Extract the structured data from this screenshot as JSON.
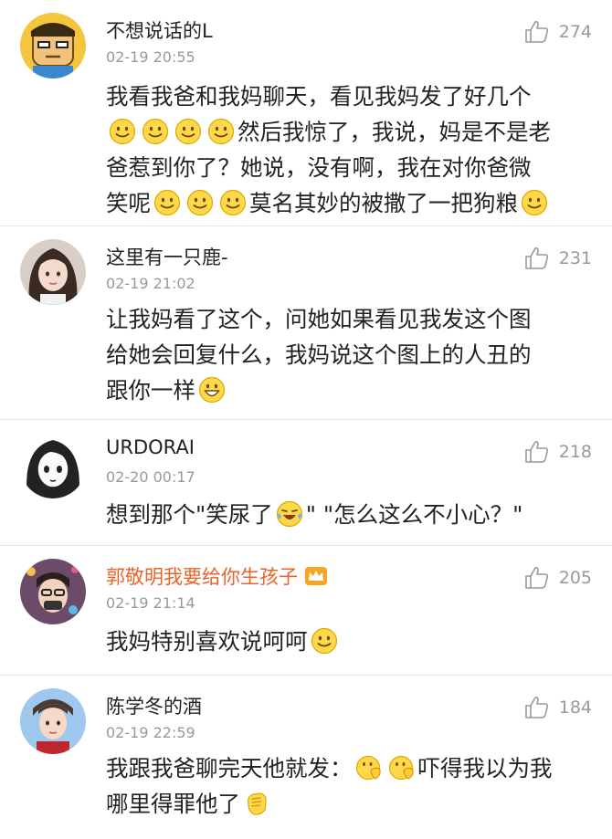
{
  "comments": [
    {
      "username": "不想说话的L",
      "time": "02-19 20:55",
      "likes": "274",
      "text": [
        "我看我爸和我妈聊天，看见我妈发了好几个",
        "然后我惊了，我说，妈是不是老",
        "爸惹到你了？她说，没有啊，我在对你爸微",
        "笑呢",
        "莫名其妙的被撒了一把狗粮"
      ]
    },
    {
      "username": "这里有一只鹿-",
      "time": "02-19 21:02",
      "likes": "231",
      "text": [
        "让我妈看了这个，问她如果看见我发这个图",
        "给她会回复什么，我妈说这个图上的人丑的",
        "跟你一样"
      ]
    },
    {
      "username": "URDORAI",
      "time": "02-20 00:17",
      "likes": "218",
      "text": [
        "想到那个\"笑尿了",
        "\" \"怎么这么不小心？\""
      ]
    },
    {
      "username": "郭敬明我要给你生孩子",
      "time": "02-19 21:14",
      "likes": "205",
      "text": [
        "我妈特别喜欢说呵呵"
      ]
    },
    {
      "username": "陈学冬的酒",
      "time": "02-19 22:59",
      "likes": "184",
      "text": [
        "我跟我爸聊完天他就发：",
        "吓得我以为我",
        "哪里得罪他了"
      ]
    }
  ]
}
